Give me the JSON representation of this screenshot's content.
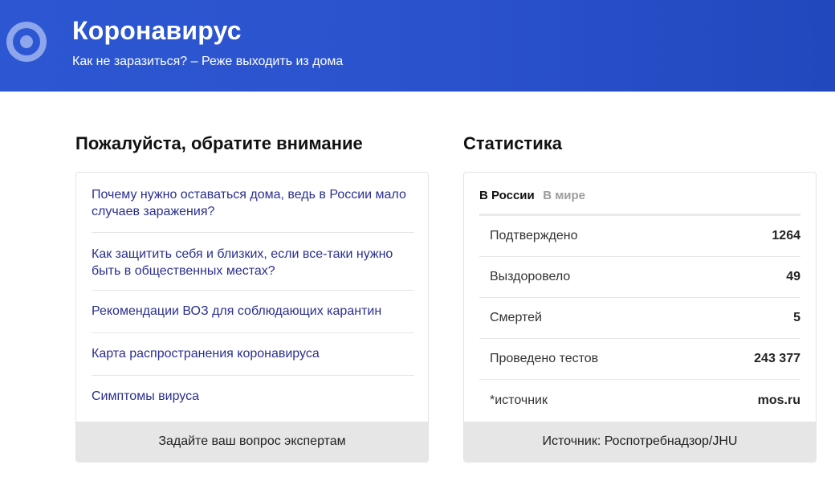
{
  "header": {
    "title": "Коронавирус",
    "subtitle": "Как не заразиться? – Реже выходить из дома"
  },
  "info": {
    "title": "Пожалуйста, обратите внимание",
    "items": [
      "Почему нужно оставаться дома, ведь в России мало случаев заражения?",
      "Как защитить себя и близких, если все-таки нужно быть в общественных местах?",
      "Рекомендации ВОЗ для соблюдающих карантин",
      "Карта распространения коронавируса",
      "Симптомы вируса"
    ],
    "footer_button": "Задайте ваш вопрос экспертам"
  },
  "stats": {
    "title": "Статистика",
    "tabs": [
      "В России",
      "В мире"
    ],
    "rows": [
      {
        "label": "Подтверждено",
        "value": "1264"
      },
      {
        "label": "Выздоровело",
        "value": "49"
      },
      {
        "label": "Смертей",
        "value": "5"
      },
      {
        "label": "Проведено тестов",
        "value": "243 377"
      },
      {
        "label": "*источник",
        "value": "mos.ru"
      }
    ],
    "footer": "Источник: Роспотребнадзор/JHU"
  },
  "colors": {
    "header_bg": "#2d57d2",
    "link": "#2a2f8f",
    "footer_bg": "#e6e6e6"
  }
}
